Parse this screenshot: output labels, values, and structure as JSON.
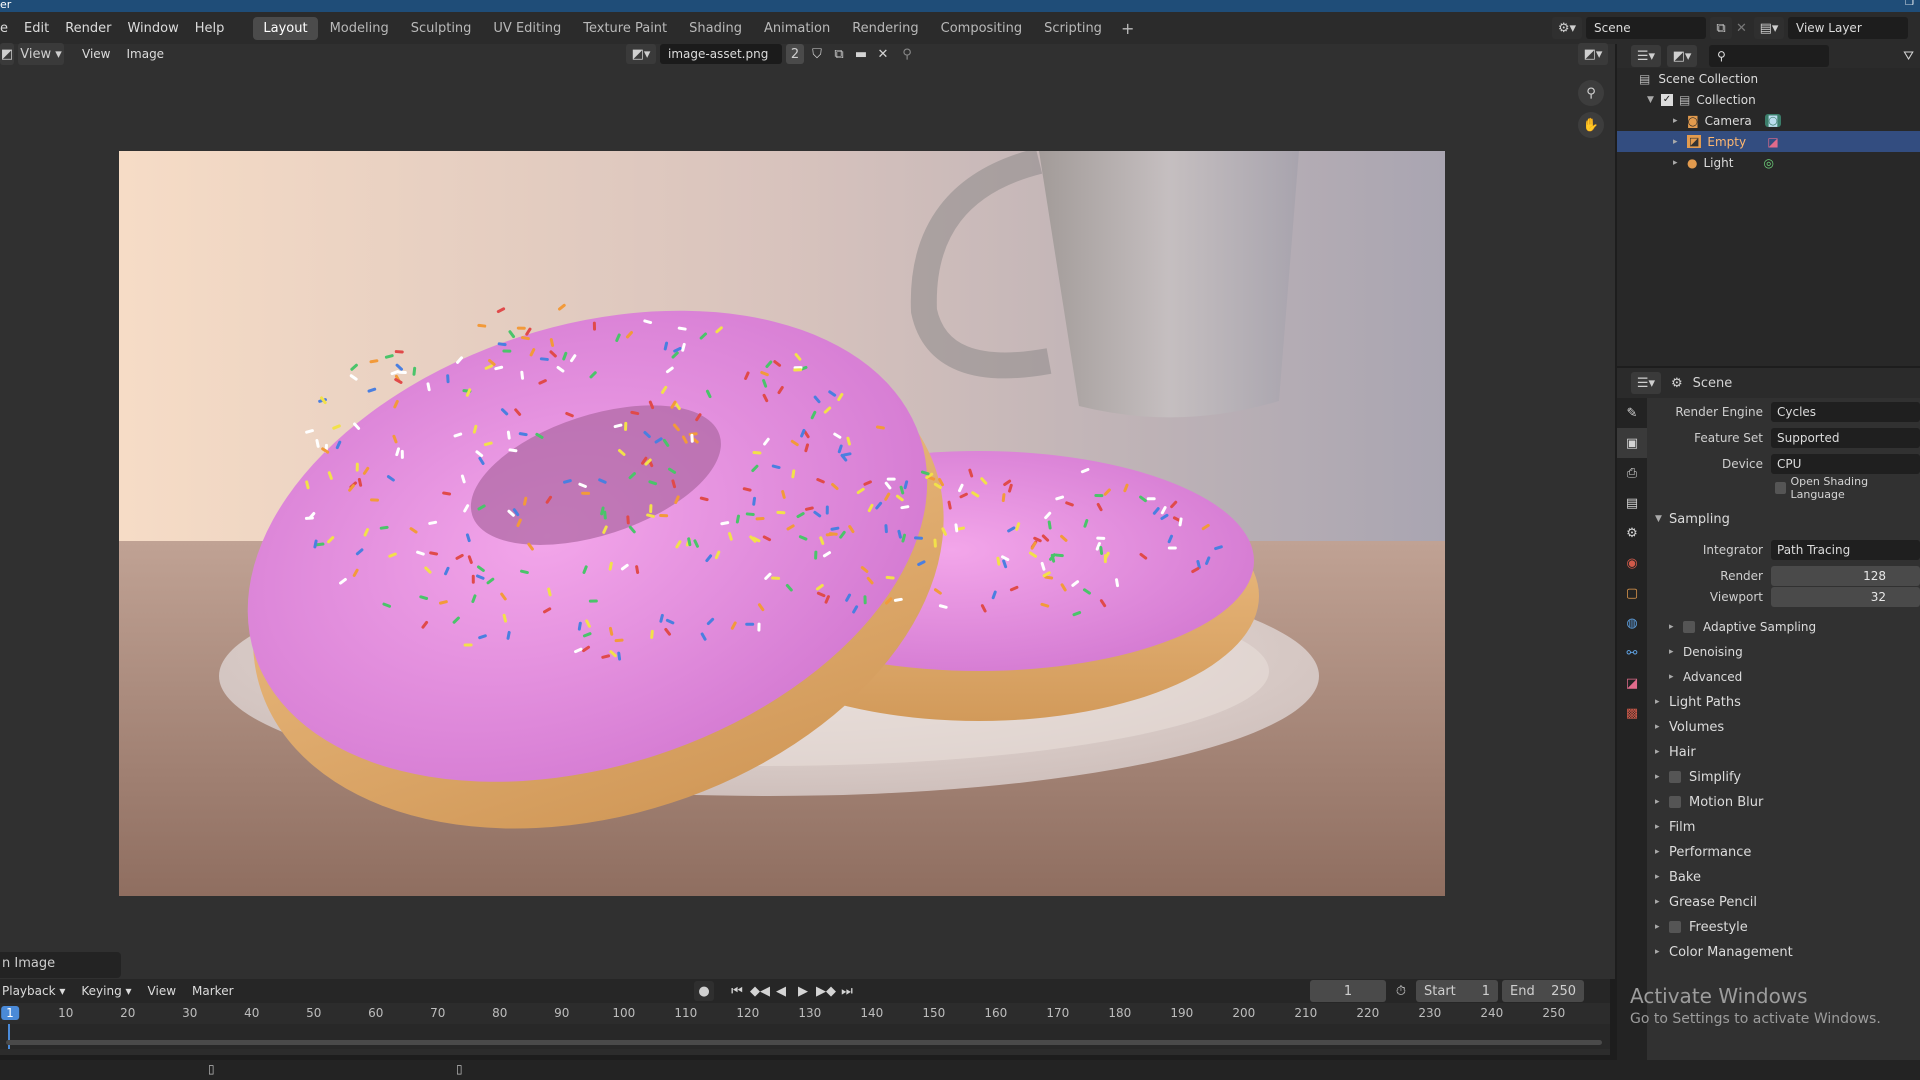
{
  "app": {
    "title_fragment": "er",
    "menus": [
      "e",
      "Edit",
      "Render",
      "Window",
      "Help"
    ],
    "workspaces": [
      "Layout",
      "Modeling",
      "Sculpting",
      "UV Editing",
      "Texture Paint",
      "Shading",
      "Animation",
      "Rendering",
      "Compositing",
      "Scripting"
    ],
    "active_workspace": "Layout",
    "scene_name": "Scene",
    "view_layer": "View Layer"
  },
  "image_editor": {
    "view_label": "View",
    "menus": [
      "View",
      "Image"
    ],
    "image_name": "image-asset.png",
    "users_count": "2",
    "status_text": "n Image"
  },
  "outliner": {
    "rows": [
      {
        "label": "Scene Collection",
        "selected": false
      },
      {
        "label": "Collection",
        "selected": false
      },
      {
        "label": "Camera",
        "selected": false
      },
      {
        "label": "Empty",
        "selected": true
      },
      {
        "label": "Light",
        "selected": false
      }
    ]
  },
  "properties": {
    "context": "Scene",
    "render_engine_label": "Render Engine",
    "render_engine": "Cycles",
    "feature_set_label": "Feature Set",
    "feature_set": "Supported",
    "device_label": "Device",
    "device": "CPU",
    "osl_label": "Open Shading Language",
    "sampling": {
      "title": "Sampling",
      "integrator_label": "Integrator",
      "integrator": "Path Tracing",
      "render_label": "Render",
      "render": "128",
      "viewport_label": "Viewport",
      "viewport": "32",
      "subpanels": [
        "Adaptive Sampling",
        "Denoising",
        "Advanced"
      ]
    },
    "panels": [
      "Light Paths",
      "Volumes",
      "Hair",
      "Simplify",
      "Motion Blur",
      "Film",
      "Performance",
      "Bake",
      "Grease Pencil",
      "Freestyle",
      "Color Management"
    ]
  },
  "timeline": {
    "menus": [
      "Playback",
      "Keying",
      "View",
      "Marker"
    ],
    "current_frame": "1",
    "start_label": "Start",
    "start": "1",
    "end_label": "End",
    "end": "250",
    "ticks": [
      "1",
      "10",
      "20",
      "30",
      "40",
      "50",
      "60",
      "70",
      "80",
      "90",
      "100",
      "110",
      "120",
      "130",
      "140",
      "150",
      "160",
      "170",
      "180",
      "190",
      "200",
      "210",
      "220",
      "230",
      "240",
      "250"
    ]
  },
  "watermark": {
    "line1": "Activate Windows",
    "line2": "Go to Settings to activate Windows."
  }
}
